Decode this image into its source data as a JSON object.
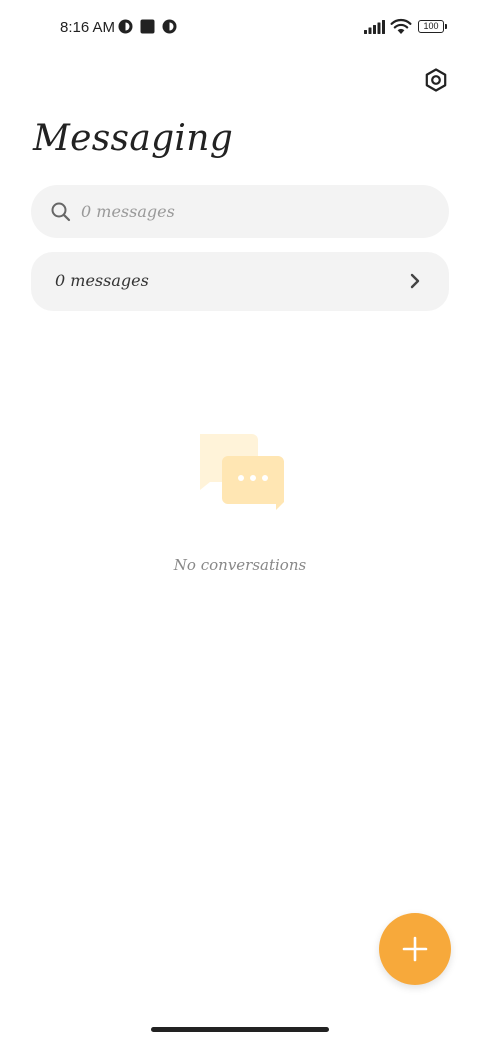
{
  "status_bar": {
    "time": "8:16 AM",
    "battery_level": "100",
    "icons": [
      "app-notification-icon",
      "stop-square-icon",
      "app-notification-icon",
      "cellular-signal-icon",
      "wifi-icon",
      "battery-icon"
    ]
  },
  "header": {
    "title": "Messaging",
    "settings_icon": "settings-hexagon-icon"
  },
  "search": {
    "placeholder": "0 messages",
    "value": ""
  },
  "messages_row": {
    "label": "0 messages"
  },
  "empty_state": {
    "icon": "chat-bubbles-icon",
    "text": "No conversations"
  },
  "fab": {
    "icon": "plus-icon"
  },
  "colors": {
    "accent": "#f7a93b",
    "surface": "#f3f3f3",
    "illustration_light": "#fff3d9",
    "illustration_mid": "#ffe6b3"
  }
}
